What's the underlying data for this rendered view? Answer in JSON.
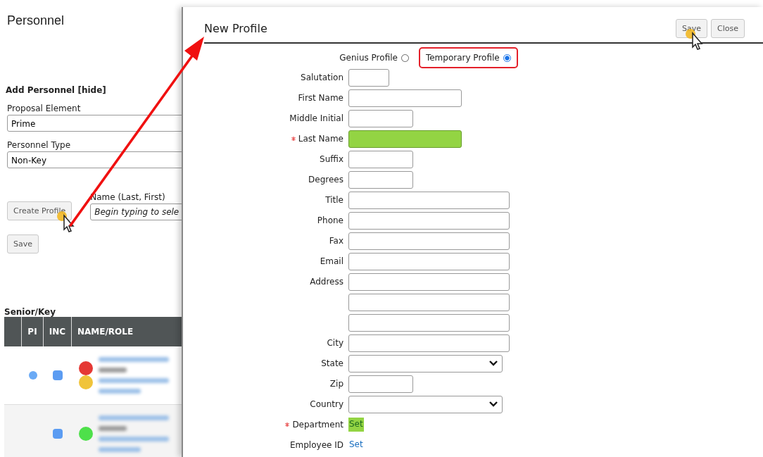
{
  "page": {
    "title": "Personnel"
  },
  "add_personnel": {
    "heading": "Add Personnel [hide]",
    "fields": [
      {
        "label": "Proposal Element",
        "value": "Prime"
      },
      {
        "label": "Personnel Type",
        "value": "Non-Key"
      }
    ],
    "create_button": "Create Profile",
    "name_field": {
      "label": "Name (Last, First)",
      "placeholder": "Begin typing to sele"
    },
    "save_button": "Save"
  },
  "senior_key": {
    "heading": "Senior/Key",
    "columns": [
      "PI",
      "INC",
      "NAME/ROLE"
    ],
    "rows": [
      {
        "pi": {
          "color": "#6aaaf5"
        },
        "inc": {
          "color": "#5b9cf2"
        },
        "status": [
          {
            "color": "#e53935"
          },
          {
            "color": "#f0c43a"
          }
        ]
      },
      {
        "inc": {
          "color": "#5b9cf2"
        },
        "status": [
          {
            "color": "#4ee04a"
          }
        ]
      }
    ]
  },
  "modal": {
    "title": "New Profile",
    "buttons": [
      "Save",
      "Close"
    ],
    "profile_types": [
      {
        "label": "Genius Profile",
        "selected": false,
        "highlighted": false
      },
      {
        "label": "Temporary Profile",
        "selected": true,
        "highlighted": true
      }
    ],
    "fields": [
      {
        "label": "Salutation",
        "kind": "tiny",
        "required": false,
        "highlighted": false
      },
      {
        "label": "First Name",
        "kind": "medium",
        "required": false,
        "highlighted": false
      },
      {
        "label": "Middle Initial",
        "kind": "short",
        "required": false,
        "highlighted": false
      },
      {
        "label": "Last Name",
        "kind": "medium",
        "required": true,
        "highlighted": true
      },
      {
        "label": "Suffix",
        "kind": "short",
        "required": false,
        "highlighted": false
      },
      {
        "label": "Degrees",
        "kind": "short",
        "required": false,
        "highlighted": false
      },
      {
        "label": "Title",
        "kind": "long",
        "required": false,
        "highlighted": false
      },
      {
        "label": "Phone",
        "kind": "long",
        "required": false,
        "highlighted": false
      },
      {
        "label": "Fax",
        "kind": "long",
        "required": false,
        "highlighted": false
      },
      {
        "label": "Email",
        "kind": "long",
        "required": false,
        "highlighted": false
      },
      {
        "label": "Address",
        "kind": "long",
        "required": false,
        "highlighted": false
      },
      {
        "kind": "long",
        "required": false,
        "highlighted": false
      },
      {
        "kind": "long",
        "required": false,
        "highlighted": false
      },
      {
        "label": "City",
        "kind": "long",
        "required": false,
        "highlighted": false
      },
      {
        "label": "State",
        "kind": "select",
        "required": false,
        "highlighted": false
      },
      {
        "label": "Zip",
        "kind": "short",
        "required": false,
        "highlighted": false
      },
      {
        "label": "Country",
        "kind": "select",
        "required": false,
        "highlighted": false
      },
      {
        "label": "Department",
        "kind": "link",
        "link": "Set",
        "required": true,
        "highlighted": true
      },
      {
        "label": "Employee ID",
        "kind": "link",
        "link": "Set",
        "required": false,
        "highlighted": false
      }
    ]
  }
}
